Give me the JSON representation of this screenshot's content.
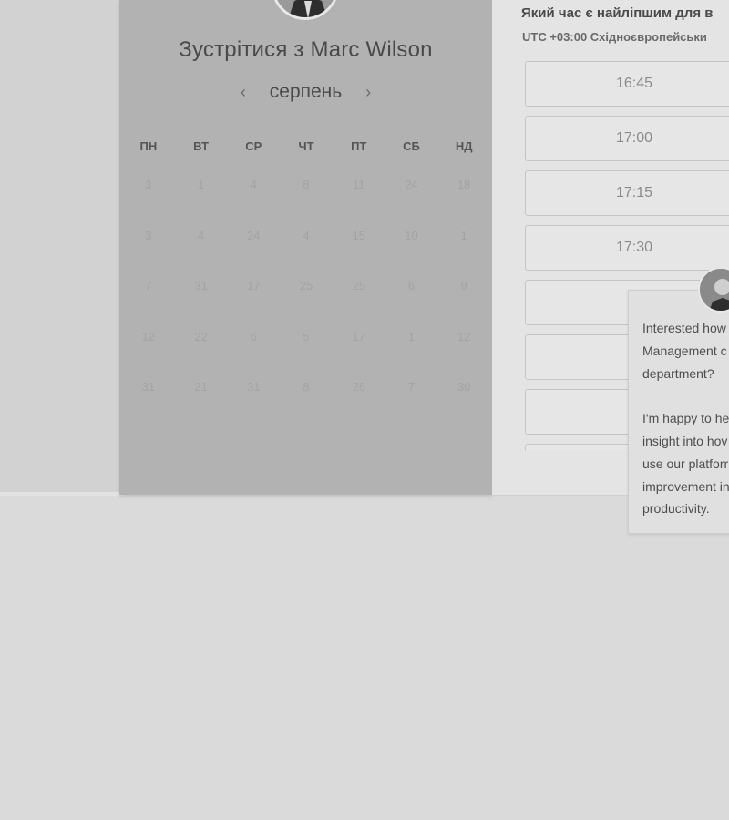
{
  "scheduler": {
    "title": "Зустрітися з Marc Wilson",
    "month": "серпень",
    "prev_icon": "‹",
    "next_icon": "›",
    "weekdays": [
      "ПН",
      "ВТ",
      "СР",
      "ЧТ",
      "ПТ",
      "СБ",
      "НД"
    ],
    "weeks": [
      [
        "3",
        "1",
        "4",
        "8",
        "11",
        "24",
        "18"
      ],
      [
        "3",
        "4",
        "24",
        "4",
        "15",
        "10",
        "1"
      ],
      [
        "7",
        "31",
        "17",
        "25",
        "25",
        "6",
        "9"
      ],
      [
        "12",
        "22",
        "6",
        "5",
        "17",
        "1",
        "12"
      ],
      [
        "31",
        "21",
        "31",
        "8",
        "26",
        "7",
        "30"
      ]
    ]
  },
  "times": {
    "question": "Який час є найліпшим для в",
    "timezone": "UTC +03:00 Східноєвропейськи",
    "slots": [
      "16:45",
      "17:00",
      "17:15",
      "17:30",
      "",
      "",
      ""
    ]
  },
  "chat": {
    "message": "Interested how\nManagement c\ndepartment?\n\nI'm happy to he\ninsight into hov\nuse our platforr\nimprovement in\nproductivity."
  },
  "icons": {
    "host_avatar": "avatar-photo",
    "chat_avatar": "avatar-photo",
    "prev": "chevron-left-icon",
    "next": "chevron-right-icon"
  }
}
